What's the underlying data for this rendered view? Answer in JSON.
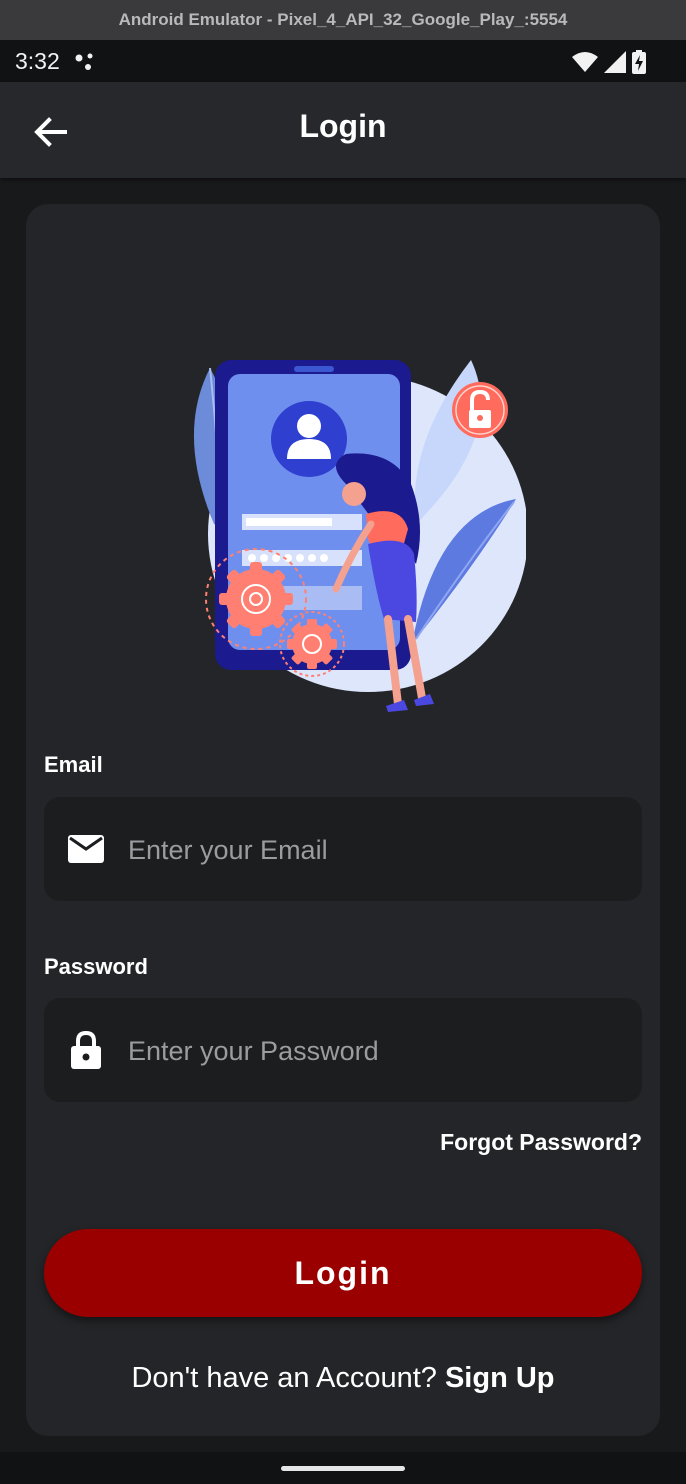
{
  "window": {
    "title": "Android Emulator - Pixel_4_API_32_Google_Play_:5554"
  },
  "statusbar": {
    "time": "3:32"
  },
  "appbar": {
    "title": "Login",
    "back_icon": "arrow-left-icon"
  },
  "illustration": {
    "name": "login-security-illustration"
  },
  "email": {
    "label": "Email",
    "placeholder": "Enter your Email",
    "value": "",
    "icon": "mail-icon"
  },
  "password": {
    "label": "Password",
    "placeholder": "Enter your Password",
    "value": "",
    "icon": "lock-icon"
  },
  "forgot_label": "Forgot Password?",
  "login_label": "Login",
  "signup": {
    "prompt": "Don't have an Account? ",
    "link": "Sign Up"
  },
  "colors": {
    "accent": "#9b0000",
    "card": "#242528",
    "field": "#1c1d1f",
    "appbar": "#27282b"
  }
}
